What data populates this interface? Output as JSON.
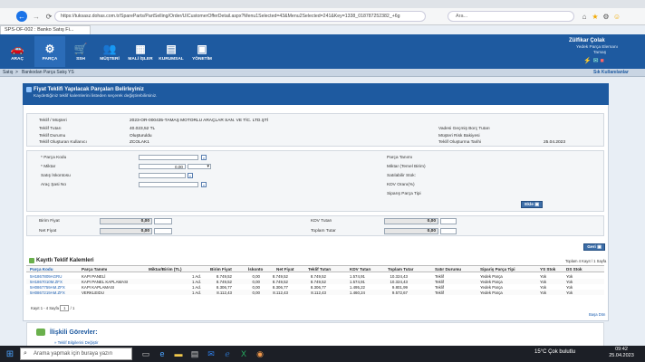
{
  "browser": {
    "url": "https://tuksasz.dohas.com.tr/SpareParts/PartSelling/Order/UICustomerOfferDetail.aspx?Menu1Selected=43&Menu2Selected=241&Key=1338_018787252382_+6g",
    "search_placeholder": "Ara...",
    "tab_title": "SPS-OF-002 : Banko Satış Fi..."
  },
  "app_menu": [
    {
      "label": "ARAÇ",
      "icon": "car-icon"
    },
    {
      "label": "PARÇA",
      "icon": "parts-icon"
    },
    {
      "label": "SSH",
      "icon": "service-icon"
    },
    {
      "label": "MÜŞTERİ",
      "icon": "customer-icon"
    },
    {
      "label": "MALİ İŞLER",
      "icon": "finance-icon"
    },
    {
      "label": "KURUMSAL",
      "icon": "corporate-icon"
    },
    {
      "label": "YÖNETİM",
      "icon": "admin-icon"
    }
  ],
  "user": {
    "name": "Zülfikar Çolak",
    "role": "Yedek Parça Elemanı",
    "org": "Tamaş"
  },
  "breadcrumb": {
    "root": "Satış",
    "sep": ">",
    "current": "Bankodan Parça Satış YS",
    "shortcut": "Sık Kullanılanlar"
  },
  "panel": {
    "title": "Fiyat Teklifi Yapılacak Parçaları Belirleyiniz",
    "subtitle": "Kaydettiğiniz teklif kalemlerini listeden seçerek değiştirebilirsiniz."
  },
  "offer": {
    "customer_label": "Teklif / Müşteri",
    "customer_value": "2023-OR-000435-TAMAŞ MOTORLU ARAÇLAR SAN. VE TİC. LTD.ŞTİ",
    "amount_label": "Teklif Tutarı",
    "amount_value": "40.023,52 TL",
    "status_label": "Teklif Durumu",
    "status_value": "Oluşturuldu",
    "creator_label": "Teklif Oluşturan Kullanıcı",
    "creator_value": "ZCOLAK1",
    "overdue_label": "Vadesi Geçmiş Borç Tutarı",
    "risk_label": "Müşteri Risk Bakiyesi",
    "date_label": "Teklif Oluşturma Tarihi",
    "date_value": "25.04.2023"
  },
  "form": {
    "part_code_label": "* Parça Kodu",
    "qty_label": "* Miktar",
    "qty_value": "0,00",
    "discount_label": "Satış İskontosu",
    "tool_label": "Araç Şasi No",
    "part_def_label": "Parça Tanımı",
    "qty_unit_label": "Miktar (Temel Birim)",
    "stock_label": "Satılabilir Stok:",
    "kdv_rate_label": "KDV Oranı(%)",
    "order_type_label": "Siparış Parça Tipi",
    "add_button": "Ekle"
  },
  "totals": {
    "unit_price_label": "Birim Fiyat",
    "unit_price_value": "0,00",
    "net_price_label": "Net Fiyat",
    "net_price_value": "0,00",
    "kdv_label": "KDV Tutarı",
    "kdv_value": "0,00",
    "total_label": "Toplam Tutar",
    "total_value": "0,00"
  },
  "table": {
    "title": "Kayıtlı Teklif Kalemleri",
    "info": "Toplam 4 Kayıt / 1 Sayfa",
    "back_button": "Geri",
    "columns": [
      "Parça Kodu",
      "Parça Tanımı",
      "Miktar/Birim (TL)",
      "Birim Fiyat",
      "İskonto",
      "Net Fiyat",
      "Teklif Tutarı",
      "KDV Tutarı",
      "Toplam Tutar",
      "Satır Durumu",
      "Sipariş Parça Tipi",
      "YS Stok",
      "DS Stok"
    ],
    "rows": [
      [
        "5H1867809AGRU",
        "KAPI PANELİ",
        "1 Ad.",
        "8.749,52",
        "0,00",
        "8.749,52",
        "8.749,52",
        "1.574,91",
        "10.324,43",
        "Teklif",
        "Yedek Parça",
        "Yok",
        "Yok"
      ],
      [
        "5H1867010M.ZFX",
        "KAPI PANEL KAPLAMASI",
        "1 Ad.",
        "8.749,52",
        "0,00",
        "8.749,52",
        "8.749,52",
        "1.574,91",
        "10.324,43",
        "Teklif",
        "Yedek Parça",
        "Yok",
        "Yok"
      ],
      [
        "5H0867759AM.ZFX",
        "KAPI KAPLAMASI",
        "1 Ad.",
        "8.306,77",
        "0,00",
        "8.306,77",
        "8.306,77",
        "1.495,22",
        "9.801,99",
        "Teklif",
        "Yedek Parça",
        "Yok",
        "Yok"
      ],
      [
        "5H0867219AM.ZFX",
        "VERKLEIDU",
        "1 Ad.",
        "8.112,43",
        "0,00",
        "8.112,43",
        "8.112,43",
        "1.460,24",
        "9.572,67",
        "Teklif",
        "Yedek Parça",
        "Yok",
        "Yok"
      ]
    ],
    "pager_prefix": "Kayıt 1 - 4 Sayfa",
    "pager_page": "1",
    "pager_total": "/ 1",
    "top_link": "Başa Dön"
  },
  "related": {
    "title": "İlişkili Görevler:",
    "link": "» Teklif Bilgilerini Değiştir"
  },
  "taskbar": {
    "search": "Arama yapmak için buraya yazın",
    "weather": "15°C  Çok bulutlu",
    "time": "09:42",
    "date": "25.04.2023"
  }
}
